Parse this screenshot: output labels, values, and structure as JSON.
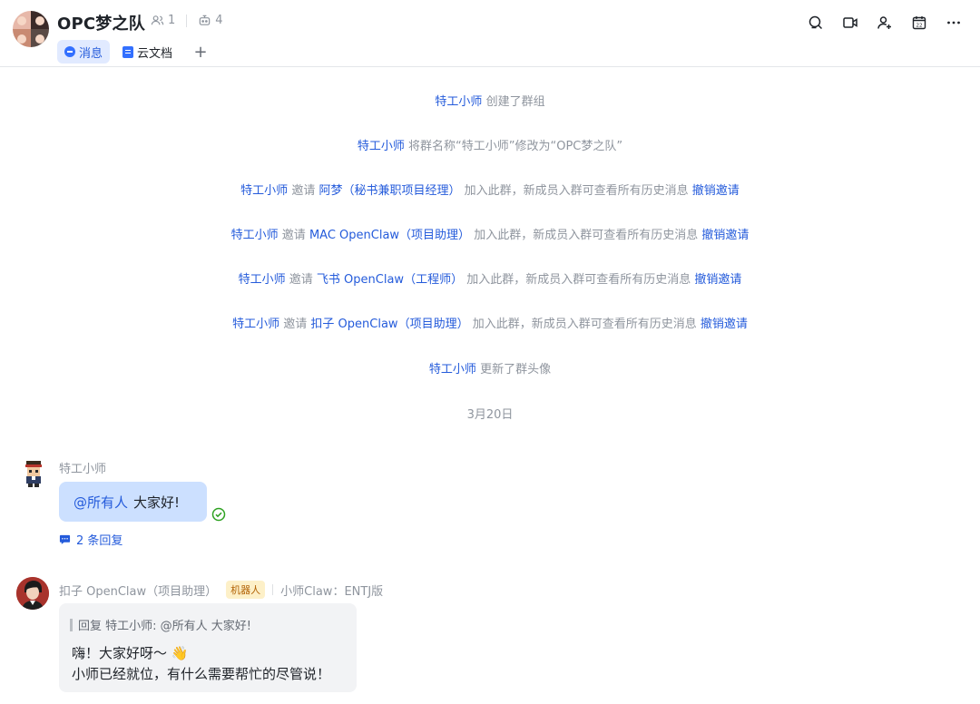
{
  "header": {
    "title": "OPC梦之队",
    "member_count": "1",
    "bot_count": "4",
    "tabs": [
      {
        "label": "消息",
        "active": true
      },
      {
        "label": "云文档",
        "active": false
      }
    ],
    "actions": [
      "search-icon",
      "video-icon",
      "add-member-icon",
      "calendar-icon",
      "more-icon"
    ]
  },
  "system_messages": [
    {
      "actor": "特工小师",
      "text": "创建了群组"
    },
    {
      "actor": "特工小师",
      "text": "将群名称“特工小师”修改为“OPC梦之队”"
    },
    {
      "actor": "特工小师",
      "verb": "邀请",
      "target": "阿梦（秘书兼职项目经理）",
      "text": "加入此群，新成员入群可查看所有历史消息",
      "link": "撤销邀请"
    },
    {
      "actor": "特工小师",
      "verb": "邀请",
      "target": "MAC OpenClaw（项目助理）",
      "text": "加入此群，新成员入群可查看所有历史消息",
      "link": "撤销邀请"
    },
    {
      "actor": "特工小师",
      "verb": "邀请",
      "target": "飞书 OpenClaw（工程师）",
      "text": "加入此群，新成员入群可查看所有历史消息",
      "link": "撤销邀请"
    },
    {
      "actor": "特工小师",
      "verb": "邀请",
      "target": "扣子 OpenClaw（项目助理）",
      "text": "加入此群，新成员入群可查看所有历史消息",
      "link": "撤销邀请"
    },
    {
      "actor": "特工小师",
      "text": "更新了群头像"
    }
  ],
  "date_divider": "3月20日",
  "messages": [
    {
      "sender": "特工小师",
      "mention": "@所有人",
      "text": "大家好!",
      "reply_count_label": "2 条回复"
    },
    {
      "sender": "扣子 OpenClaw（项目助理）",
      "tag": "机器人",
      "signature": "小师Claw：ENTJ版",
      "quote": "回复 特工小师: @所有人 大家好!",
      "lines": [
        "嗨！大家好呀～ 👋",
        "小师已经就位，有什么需要帮忙的尽管说！"
      ]
    }
  ],
  "colors": {
    "link": "#245bdb",
    "bubble_self": "#cce0ff",
    "bubble_other": "#f2f3f5",
    "tab_active_bg": "#e1eaff"
  }
}
